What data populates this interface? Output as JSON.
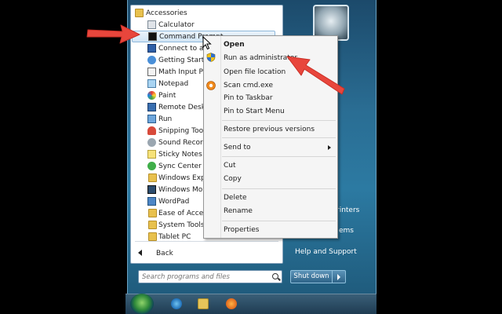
{
  "start_menu": {
    "programs": [
      {
        "label": "Accessories",
        "icon": "folder-icon",
        "kind": "folder"
      },
      {
        "label": "Calculator",
        "icon": "calculator-icon",
        "kind": "app"
      },
      {
        "label": "Command Prompt",
        "icon": "cmd-icon",
        "kind": "app",
        "selected": true
      },
      {
        "label": "Connect to a ",
        "icon": "projector-icon",
        "kind": "app"
      },
      {
        "label": "Getting Starte",
        "icon": "getting-started-icon",
        "kind": "app"
      },
      {
        "label": "Math Input Pa",
        "icon": "math-input-icon",
        "kind": "app"
      },
      {
        "label": "Notepad",
        "icon": "notepad-icon",
        "kind": "app"
      },
      {
        "label": "Paint",
        "icon": "paint-icon",
        "kind": "app"
      },
      {
        "label": "Remote Deskt",
        "icon": "remote-desktop-icon",
        "kind": "app"
      },
      {
        "label": "Run",
        "icon": "run-icon",
        "kind": "app"
      },
      {
        "label": "Snipping Tool",
        "icon": "snipping-tool-icon",
        "kind": "app"
      },
      {
        "label": "Sound Record",
        "icon": "sound-recorder-icon",
        "kind": "app"
      },
      {
        "label": "Sticky Notes",
        "icon": "sticky-notes-icon",
        "kind": "app"
      },
      {
        "label": "Sync Center",
        "icon": "sync-center-icon",
        "kind": "app"
      },
      {
        "label": "Windows Expl",
        "icon": "windows-explorer-icon",
        "kind": "app"
      },
      {
        "label": "Windows Mob",
        "icon": "windows-mobility-icon",
        "kind": "app"
      },
      {
        "label": "WordPad",
        "icon": "wordpad-icon",
        "kind": "app"
      },
      {
        "label": "Ease of Access",
        "icon": "folder-icon",
        "kind": "folder"
      },
      {
        "label": "System Tools",
        "icon": "folder-icon",
        "kind": "folder"
      },
      {
        "label": "Tablet PC",
        "icon": "folder-icon",
        "kind": "folder"
      }
    ],
    "back_label": "Back",
    "search_placeholder": "Search programs and files",
    "right_pane": {
      "partial_items": [
        "rinters",
        "ems"
      ],
      "help_label": "Help and Support",
      "shutdown_label": "Shut down"
    }
  },
  "context_menu": {
    "items": [
      {
        "label": "Open",
        "bold": true
      },
      {
        "label": "Run as administrator",
        "icon": "uac-shield-icon"
      },
      {
        "label": "Open file location"
      },
      {
        "label": "Scan cmd.exe",
        "icon": "antivirus-icon"
      },
      {
        "label": "Pin to Taskbar"
      },
      {
        "label": "Pin to Start Menu"
      },
      {
        "label": "Restore previous versions"
      },
      {
        "label": "Send to",
        "submenu": true
      },
      {
        "label": "Cut"
      },
      {
        "label": "Copy"
      },
      {
        "label": "Delete"
      },
      {
        "label": "Rename"
      },
      {
        "label": "Properties"
      }
    ]
  },
  "taskbar": {
    "icons": [
      "windows-orb-icon",
      "internet-explorer-icon",
      "explorer-folder-icon",
      "media-player-icon"
    ]
  },
  "colors": {
    "annotation_red": "#e8463c",
    "start_menu_blue": "#2a6d93",
    "selection_blue": "#d2e6f6"
  }
}
